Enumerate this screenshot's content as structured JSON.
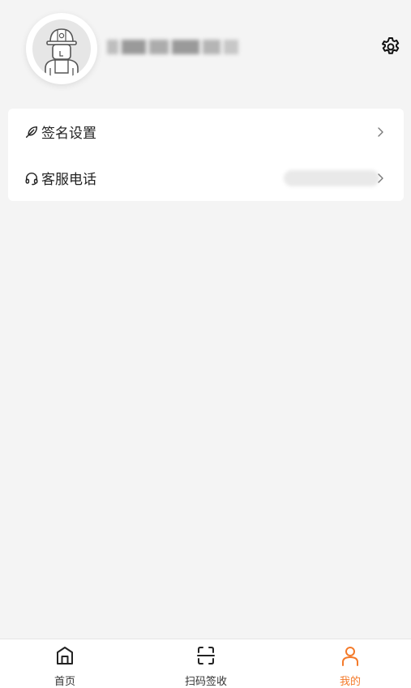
{
  "profile": {
    "username": "",
    "avatar_icon": "worker-avatar-icon"
  },
  "header": {
    "settings_icon": "gear-icon"
  },
  "menu": {
    "items": [
      {
        "label": "签名设置",
        "icon": "feather-pen-icon",
        "value": ""
      },
      {
        "label": "客服电话",
        "icon": "headset-icon",
        "value": ""
      }
    ]
  },
  "bottom_nav": {
    "items": [
      {
        "label": "首页",
        "icon": "home-icon",
        "active": false
      },
      {
        "label": "扫码签收",
        "icon": "scan-icon",
        "active": false
      },
      {
        "label": "我的",
        "icon": "person-icon",
        "active": true
      }
    ],
    "active_color": "#f47a2a",
    "inactive_color": "#333333"
  }
}
